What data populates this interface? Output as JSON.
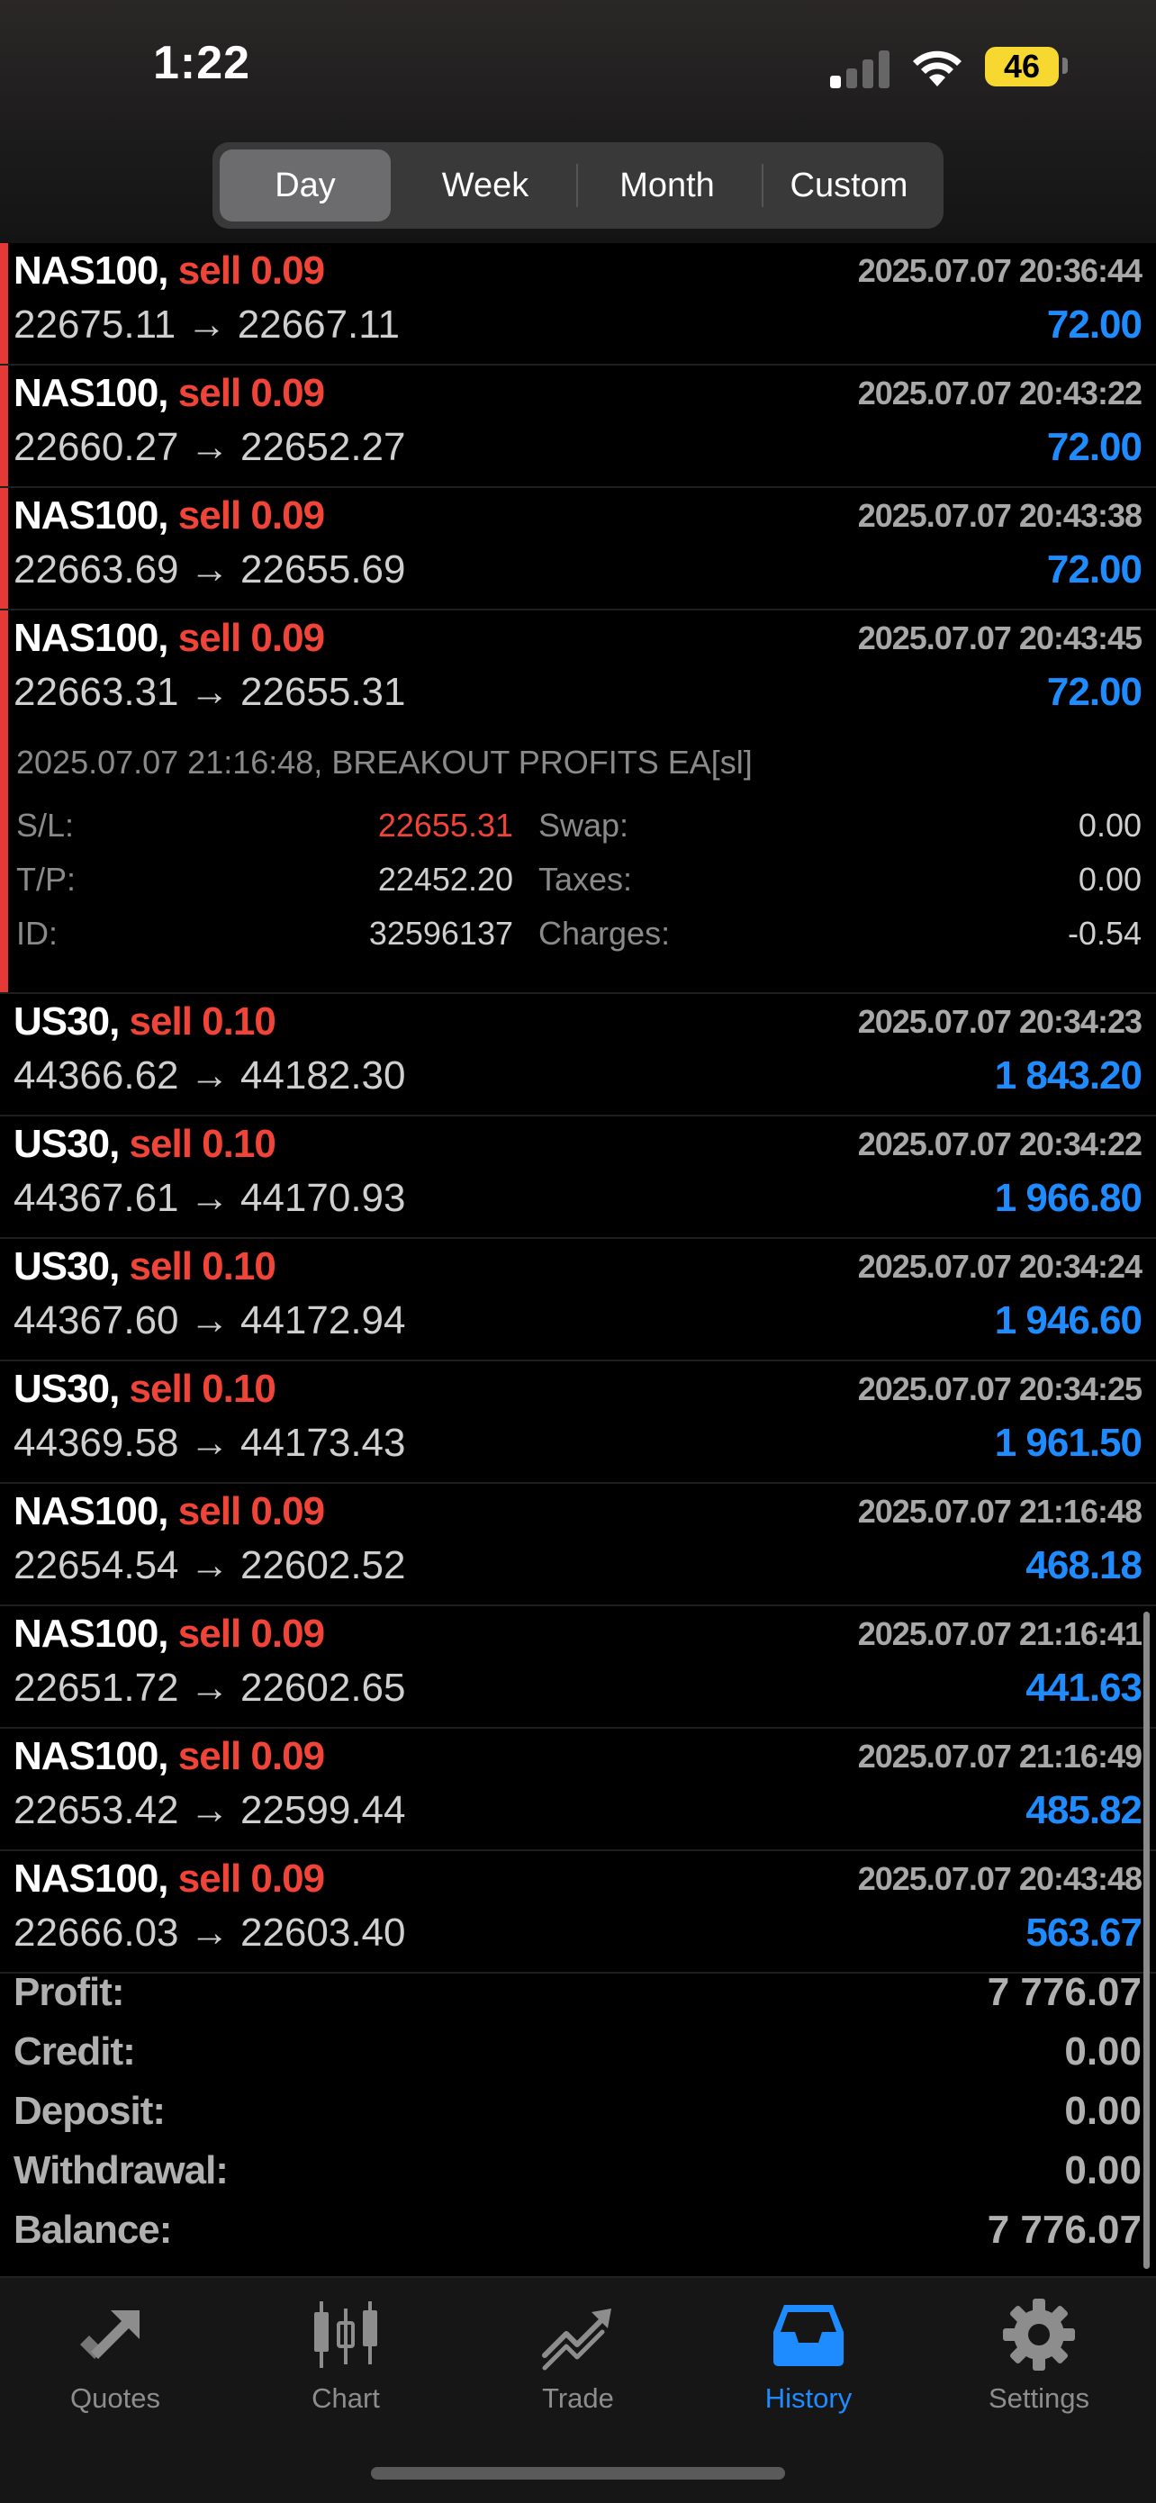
{
  "status_bar": {
    "time": "1:22",
    "battery": "46"
  },
  "segments": [
    "Day",
    "Week",
    "Month",
    "Custom"
  ],
  "active_segment": "Day",
  "deals_group1": [
    {
      "symbol": "NAS100,",
      "side": "sell 0.09",
      "datetime": "2025.07.07 20:36:44",
      "prices": "22675.11 → 22667.11",
      "profit": "72.00"
    },
    {
      "symbol": "NAS100,",
      "side": "sell 0.09",
      "datetime": "2025.07.07 20:43:22",
      "prices": "22660.27 → 22652.27",
      "profit": "72.00"
    },
    {
      "symbol": "NAS100,",
      "side": "sell 0.09",
      "datetime": "2025.07.07 20:43:38",
      "prices": "22663.69 → 22655.69",
      "profit": "72.00"
    },
    {
      "symbol": "NAS100,",
      "side": "sell 0.09",
      "datetime": "2025.07.07 20:43:45",
      "prices": "22663.31 → 22655.31",
      "profit": "72.00"
    }
  ],
  "details": {
    "comment": "2025.07.07 21:16:48, BREAKOUT PROFITS EA[sl]",
    "sl_label": "S/L:",
    "sl_value": "22655.31",
    "tp_label": "T/P:",
    "tp_value": "22452.20",
    "id_label": "ID:",
    "id_value": "32596137",
    "swap_label": "Swap:",
    "swap_value": "0.00",
    "taxes_label": "Taxes:",
    "taxes_value": "0.00",
    "charges_label": "Charges:",
    "charges_value": "-0.54"
  },
  "deals_group2": [
    {
      "symbol": "US30,",
      "side": "sell 0.10",
      "datetime": "2025.07.07 20:34:23",
      "prices": "44366.62 → 44182.30",
      "profit": "1 843.20"
    },
    {
      "symbol": "US30,",
      "side": "sell 0.10",
      "datetime": "2025.07.07 20:34:22",
      "prices": "44367.61 → 44170.93",
      "profit": "1 966.80"
    },
    {
      "symbol": "US30,",
      "side": "sell 0.10",
      "datetime": "2025.07.07 20:34:24",
      "prices": "44367.60 → 44172.94",
      "profit": "1 946.60"
    },
    {
      "symbol": "US30,",
      "side": "sell 0.10",
      "datetime": "2025.07.07 20:34:25",
      "prices": "44369.58 → 44173.43",
      "profit": "1 961.50"
    },
    {
      "symbol": "NAS100,",
      "side": "sell 0.09",
      "datetime": "2025.07.07 21:16:48",
      "prices": "22654.54 → 22602.52",
      "profit": "468.18"
    },
    {
      "symbol": "NAS100,",
      "side": "sell 0.09",
      "datetime": "2025.07.07 21:16:41",
      "prices": "22651.72 → 22602.65",
      "profit": "441.63"
    },
    {
      "symbol": "NAS100,",
      "side": "sell 0.09",
      "datetime": "2025.07.07 21:16:49",
      "prices": "22653.42 → 22599.44",
      "profit": "485.82"
    },
    {
      "symbol": "NAS100,",
      "side": "sell 0.09",
      "datetime": "2025.07.07 20:43:48",
      "prices": "22666.03 → 22603.40",
      "profit": "563.67"
    }
  ],
  "summary": [
    {
      "label": "Profit:",
      "value": "7 776.07"
    },
    {
      "label": "Credit:",
      "value": "0.00"
    },
    {
      "label": "Deposit:",
      "value": "0.00"
    },
    {
      "label": "Withdrawal:",
      "value": "0.00"
    },
    {
      "label": "Balance:",
      "value": "7 776.07"
    }
  ],
  "tabs": [
    {
      "label": "Quotes",
      "icon": "quotes-icon"
    },
    {
      "label": "Chart",
      "icon": "chart-icon"
    },
    {
      "label": "Trade",
      "icon": "trade-icon"
    },
    {
      "label": "History",
      "icon": "history-icon"
    },
    {
      "label": "Settings",
      "icon": "gear-icon"
    }
  ],
  "active_tab": "History",
  "colors": {
    "sell": "#f04438",
    "profit": "#1e8cff",
    "accent": "#1e8cff"
  }
}
